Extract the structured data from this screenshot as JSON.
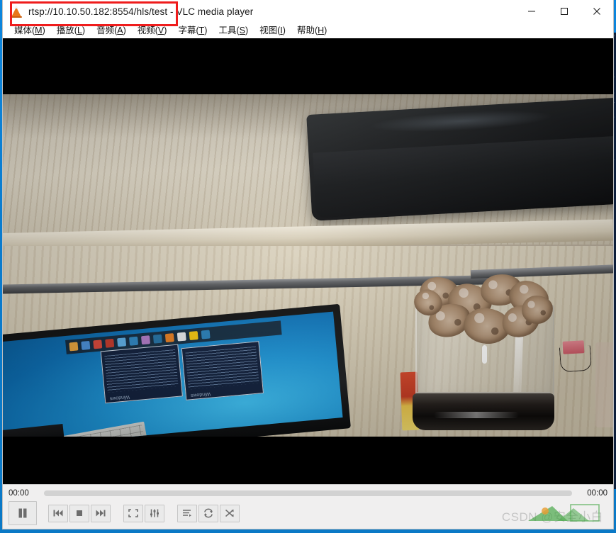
{
  "window": {
    "title": "rtsp://10.10.50.182:8554/hls/test - VLC media player",
    "app_name": "VLC media player",
    "stream_url": "rtsp://10.10.50.182:8554/hls/test",
    "logo_icon": "vlc-cone-icon"
  },
  "titlebar_controls": {
    "minimize": {
      "label": "—",
      "icon": "minimize-icon"
    },
    "maximize": {
      "label": "□",
      "icon": "maximize-icon"
    },
    "close": {
      "label": "✕",
      "icon": "close-icon"
    }
  },
  "annotation": {
    "type": "red-rectangle-highlight",
    "color": "#ef1c1c",
    "target": "window-title"
  },
  "menubar": {
    "items": [
      {
        "name": "media",
        "text": "媒体",
        "mnemonic": "M"
      },
      {
        "name": "playback",
        "text": "播放",
        "mnemonic": "L"
      },
      {
        "name": "audio",
        "text": "音频",
        "mnemonic": "A"
      },
      {
        "name": "video",
        "text": "视频",
        "mnemonic": "V"
      },
      {
        "name": "subtitle",
        "text": "字幕",
        "mnemonic": "T"
      },
      {
        "name": "tools",
        "text": "工具",
        "mnemonic": "S"
      },
      {
        "name": "view",
        "text": "视图",
        "mnemonic": "I"
      },
      {
        "name": "help",
        "text": "帮助",
        "mnemonic": "H"
      }
    ]
  },
  "video": {
    "description": "Live RTSP camera feed: upside-down photo of a wooden desk with a black electronic device, a glass storage jar with a black lid holding dried mushrooms, and a computer monitor showing a blue Windows desktop.",
    "letterbox_color": "#000000"
  },
  "controls": {
    "elapsed_time": "00:00",
    "total_time": "00:00",
    "seek_position_percent": 0,
    "buttons": [
      {
        "name": "play-pause",
        "icon": "pause-icon",
        "state": "playing"
      },
      {
        "name": "previous",
        "icon": "previous-icon"
      },
      {
        "name": "stop",
        "icon": "stop-icon"
      },
      {
        "name": "next",
        "icon": "next-icon"
      },
      {
        "name": "fullscreen",
        "icon": "fullscreen-icon"
      },
      {
        "name": "settings",
        "icon": "equalizer-icon"
      },
      {
        "name": "playlist",
        "icon": "playlist-icon"
      },
      {
        "name": "loop",
        "icon": "loop-icon"
      },
      {
        "name": "shuffle",
        "icon": "shuffle-icon"
      }
    ]
  },
  "watermark": {
    "text": "CSDN @安全小白"
  },
  "background": {
    "desktop_color": "#0b7fd4",
    "terminal_lines": [
      "00",
      "1.",
      "-q",
      "e-",
      "-]",
      "ab",
      "",
      "Le",
      "La",
      "",
      "be",
      "en",
      "ts",
      "-j",
      "",
      "ti",
      "2-",
      "",
      "9.",
      "1.",
      "1.",
      "1.",
      "0.",
      "3.",
      "5.",
      "3.",
      "",
      "e",
      "n"
    ]
  }
}
